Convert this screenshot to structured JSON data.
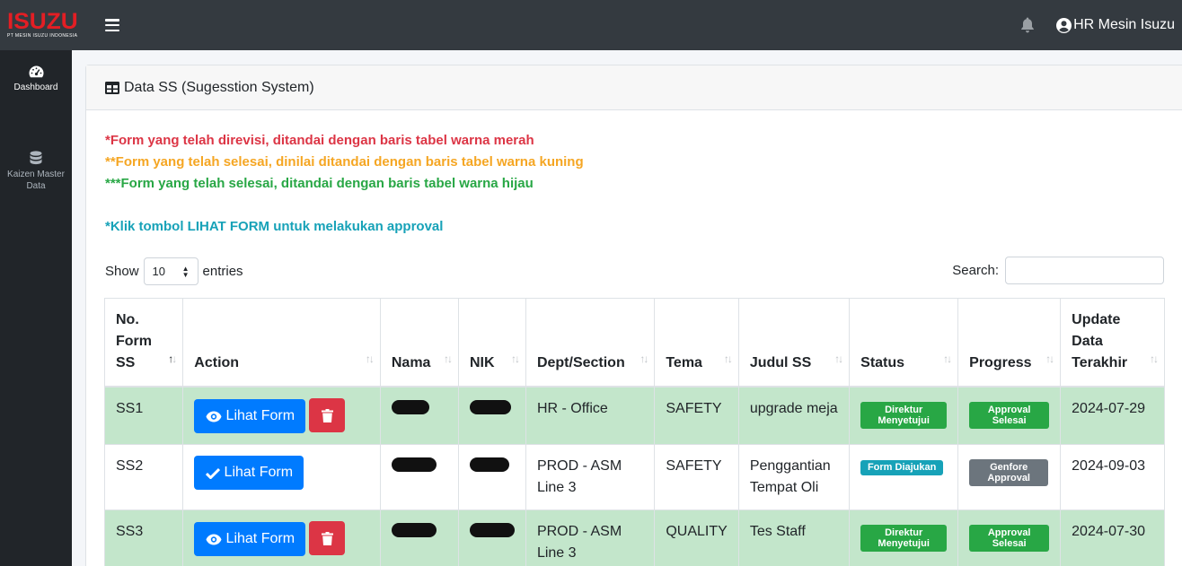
{
  "brand": {
    "logo": "ISUZU",
    "subtitle": "PT MESIN ISUZU INDONESIA"
  },
  "topbar": {
    "user_name": "HR Mesin Isuzu"
  },
  "sidebar": {
    "items": [
      {
        "label": "Dashboard",
        "icon": "gauge-icon"
      },
      {
        "label": "Kaizen Master Data",
        "icon": "database-icon"
      }
    ]
  },
  "card": {
    "title": "Data SS (Sugesstion System)",
    "notes": {
      "red": "*Form yang telah direvisi, ditandai dengan baris tabel warna merah",
      "yellow": "**Form yang telah selesai, dinilai ditandai dengan baris tabel warna kuning",
      "green": "***Form yang telah selesai, ditandai dengan baris tabel warna hijau",
      "blue": "*Klik tombol LIHAT FORM untuk melakukan approval"
    },
    "length": {
      "show_label": "Show",
      "value": "10",
      "entries_label": "entries"
    },
    "search": {
      "label": "Search:",
      "value": ""
    }
  },
  "table": {
    "headers": [
      "No. Form SS",
      "Action",
      "Nama",
      "NIK",
      "Dept/Section",
      "Tema",
      "Judul SS",
      "Status",
      "Progress",
      "Update Data Terakhir"
    ],
    "rows": [
      {
        "no": "SS1",
        "action_label": "Lihat Form",
        "dept": "HR - Office",
        "tema": "SAFETY",
        "judul": "upgrade meja",
        "status": "Direktur Menyetujui",
        "progress": "Approval Selesai",
        "updated": "2024-07-29"
      },
      {
        "no": "SS2",
        "action_label": "Lihat Form",
        "dept": "PROD - ASM Line 3",
        "tema": "SAFETY",
        "judul": "Penggantian Tempat Oli",
        "status": "Form Diajukan",
        "progress": "Genfore Approval",
        "updated": "2024-09-03"
      },
      {
        "no": "SS3",
        "action_label": "Lihat Form",
        "dept": "PROD - ASM Line 3",
        "tema": "QUALITY",
        "judul": "Tes Staff",
        "status": "Direktur Menyetujui",
        "progress": "Approval Selesai",
        "updated": "2024-07-30"
      }
    ]
  },
  "colors": {
    "navbar": "#343a40",
    "sidebar": "#212529",
    "primary": "#007bff",
    "danger": "#dc3545",
    "success": "#28a745",
    "info": "#17a2b8",
    "secondary": "#6c757d",
    "row_green": "#c3e6cb",
    "brand_red": "#e31e24"
  }
}
